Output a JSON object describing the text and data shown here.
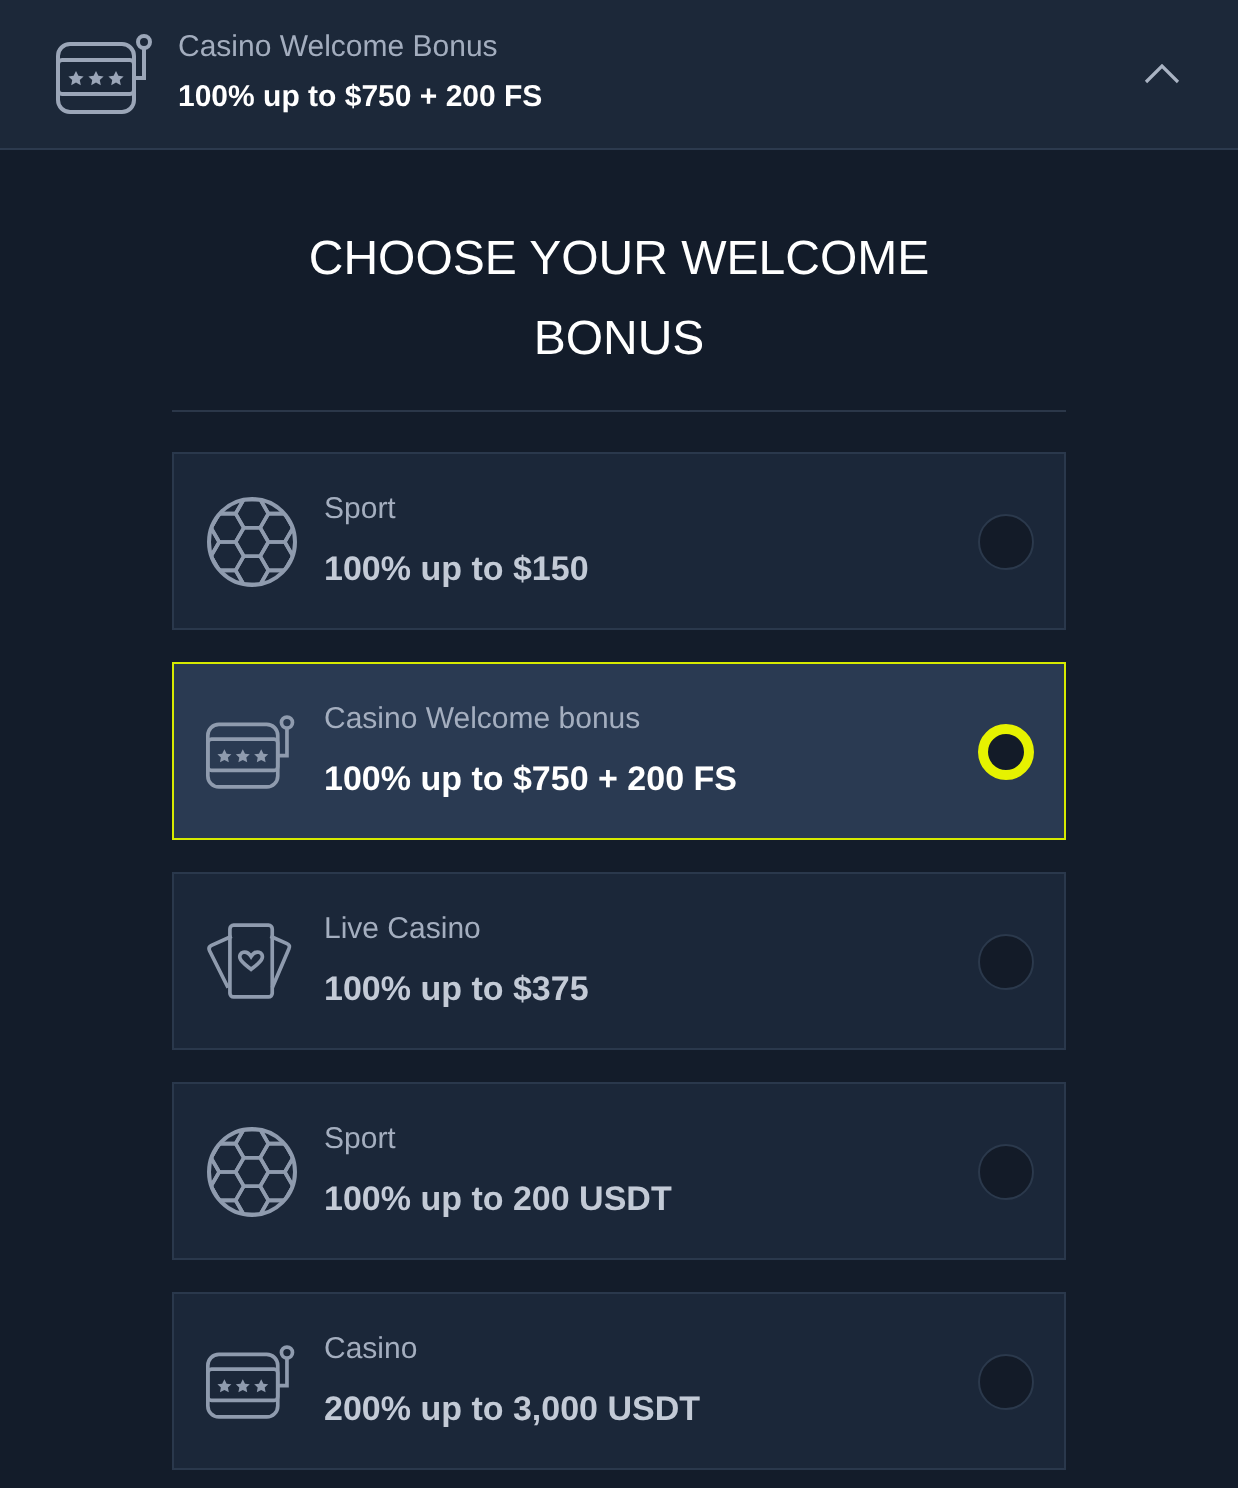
{
  "header": {
    "kind": "slot",
    "title": "Casino Welcome Bonus",
    "value": "100% up to $750 + 200 FS",
    "expanded": true
  },
  "heading": "CHOOSE YOUR WELCOME BONUS",
  "options": [
    {
      "kind": "sport",
      "label": "Sport",
      "value": "100% up to $150",
      "selected": false
    },
    {
      "kind": "slot",
      "label": "Casino Welcome bonus",
      "value": "100% up to $750 + 200 FS",
      "selected": true
    },
    {
      "kind": "cards",
      "label": "Live Casino",
      "value": "100% up to $375",
      "selected": false
    },
    {
      "kind": "sport",
      "label": "Sport",
      "value": "100% up to 200 USDT",
      "selected": false
    },
    {
      "kind": "slot",
      "label": "Casino",
      "value": "200% up to 3,000 USDT",
      "selected": false
    }
  ]
}
